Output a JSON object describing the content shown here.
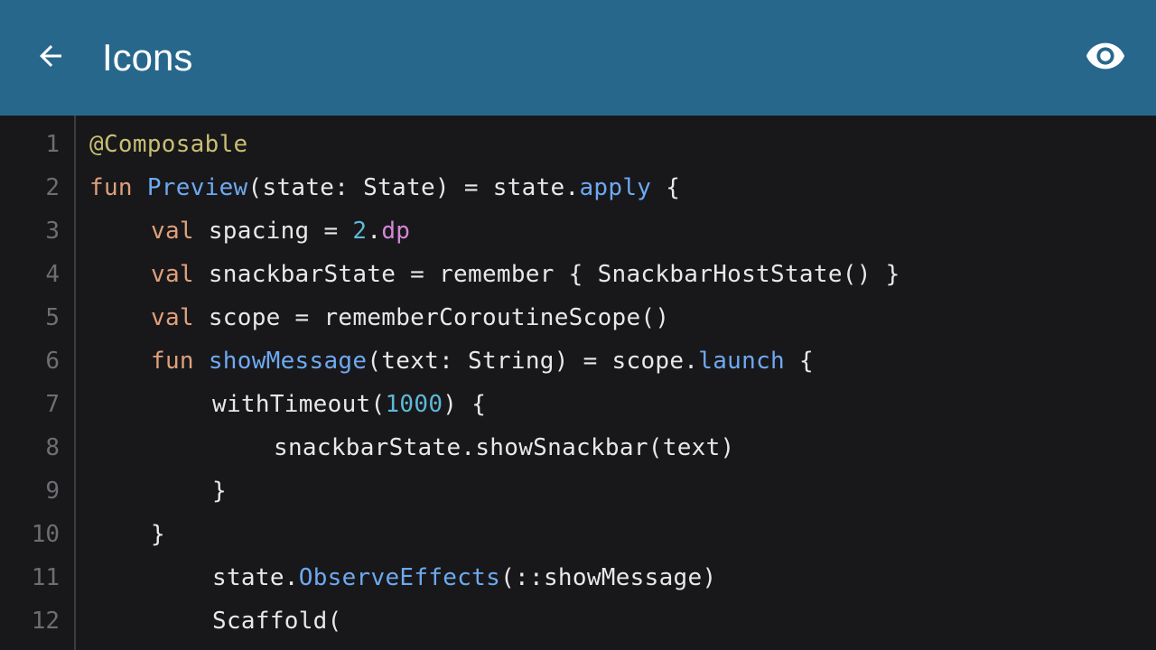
{
  "app_bar": {
    "title": "Icons",
    "back_icon": "arrow-back-icon",
    "preview_icon": "eye-icon",
    "background": "#27678c"
  },
  "editor": {
    "background": "#18181b",
    "lines": [
      {
        "number": "1",
        "indent": 0,
        "tokens": [
          {
            "t": "ann",
            "s": "@Composable"
          }
        ]
      },
      {
        "number": "2",
        "indent": 0,
        "tokens": [
          {
            "t": "kw",
            "s": "fun "
          },
          {
            "t": "fn",
            "s": "Preview"
          },
          {
            "t": "plain",
            "s": "(state: State) = state."
          },
          {
            "t": "fn",
            "s": "apply"
          },
          {
            "t": "plain",
            "s": " {"
          }
        ]
      },
      {
        "number": "3",
        "indent": 1,
        "tokens": [
          {
            "t": "kw",
            "s": "val "
          },
          {
            "t": "plain",
            "s": "spacing = "
          },
          {
            "t": "num",
            "s": "2"
          },
          {
            "t": "plain",
            "s": "."
          },
          {
            "t": "prop",
            "s": "dp"
          }
        ]
      },
      {
        "number": "4",
        "indent": 1,
        "tokens": [
          {
            "t": "kw",
            "s": "val "
          },
          {
            "t": "plain",
            "s": "snackbarState = remember { SnackbarHostState() }"
          }
        ]
      },
      {
        "number": "5",
        "indent": 1,
        "tokens": [
          {
            "t": "kw",
            "s": "val "
          },
          {
            "t": "plain",
            "s": "scope = rememberCoroutineScope()"
          }
        ]
      },
      {
        "number": "6",
        "indent": 1,
        "tokens": [
          {
            "t": "kw",
            "s": "fun "
          },
          {
            "t": "fn",
            "s": "showMessage"
          },
          {
            "t": "plain",
            "s": "(text: String) = scope."
          },
          {
            "t": "fn",
            "s": "launch"
          },
          {
            "t": "plain",
            "s": " {"
          }
        ]
      },
      {
        "number": "7",
        "indent": 2,
        "tokens": [
          {
            "t": "plain",
            "s": "withTimeout("
          },
          {
            "t": "num",
            "s": "1000"
          },
          {
            "t": "plain",
            "s": ") {"
          }
        ]
      },
      {
        "number": "8",
        "indent": 3,
        "tokens": [
          {
            "t": "plain",
            "s": "snackbarState.showSnackbar(text)"
          }
        ]
      },
      {
        "number": "9",
        "indent": 2,
        "tokens": [
          {
            "t": "plain",
            "s": "}"
          }
        ]
      },
      {
        "number": "10",
        "indent": 1,
        "tokens": [
          {
            "t": "plain",
            "s": "}"
          }
        ]
      },
      {
        "number": "11",
        "indent": 2,
        "tokens": [
          {
            "t": "plain",
            "s": "state."
          },
          {
            "t": "fn",
            "s": "ObserveEffects"
          },
          {
            "t": "plain",
            "s": "(::showMessage)"
          }
        ]
      },
      {
        "number": "12",
        "indent": 2,
        "tokens": [
          {
            "t": "plain",
            "s": "Scaffold("
          }
        ]
      }
    ]
  }
}
